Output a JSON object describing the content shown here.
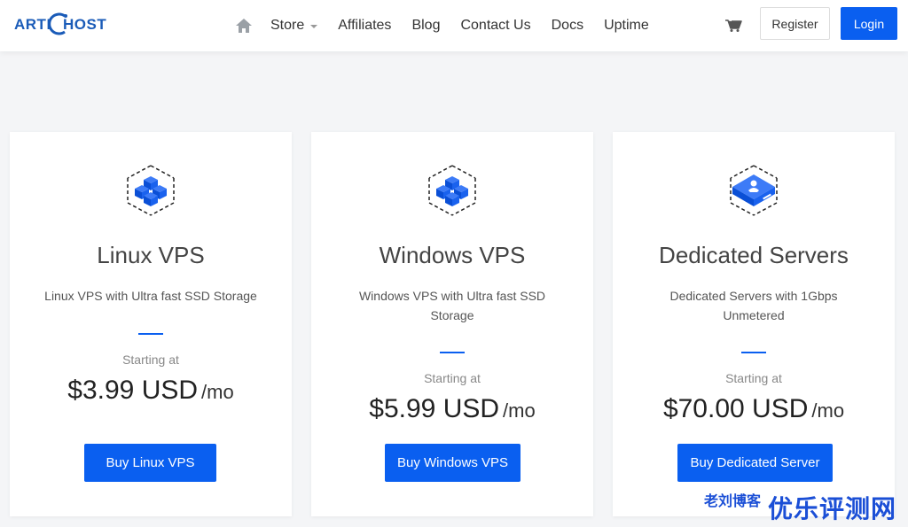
{
  "brand": {
    "logo_left": "ARTI",
    "logo_right": "HOST"
  },
  "nav": {
    "home_icon": "home-icon",
    "items": [
      "Store",
      "Affiliates",
      "Blog",
      "Contact Us",
      "Docs",
      "Uptime"
    ]
  },
  "header": {
    "cart_icon": "cart-icon",
    "register_label": "Register",
    "login_label": "Login"
  },
  "plans": [
    {
      "icon": "cubes-icon",
      "title": "Linux VPS",
      "description": "Linux VPS with Ultra fast SSD Storage",
      "starting_label": "Starting at",
      "price": "$3.99 USD",
      "per": "/mo",
      "button": "Buy Linux VPS"
    },
    {
      "icon": "cubes-icon",
      "title": "Windows VPS",
      "description": "Windows VPS with Ultra fast SSD Storage",
      "starting_label": "Starting at",
      "price": "$5.99 USD",
      "per": "/mo",
      "button": "Buy Windows VPS"
    },
    {
      "icon": "server-icon",
      "title": "Dedicated Servers",
      "description": "Dedicated Servers with 1Gbps Unmetered",
      "starting_label": "Starting at",
      "price": "$70.00 USD",
      "per": "/mo",
      "button": "Buy Dedicated Server"
    }
  ],
  "watermark": {
    "small": "老刘博客",
    "big": "优乐评测网"
  },
  "colors": {
    "accent": "#0a5ff0",
    "brand": "#1a5bb8"
  }
}
